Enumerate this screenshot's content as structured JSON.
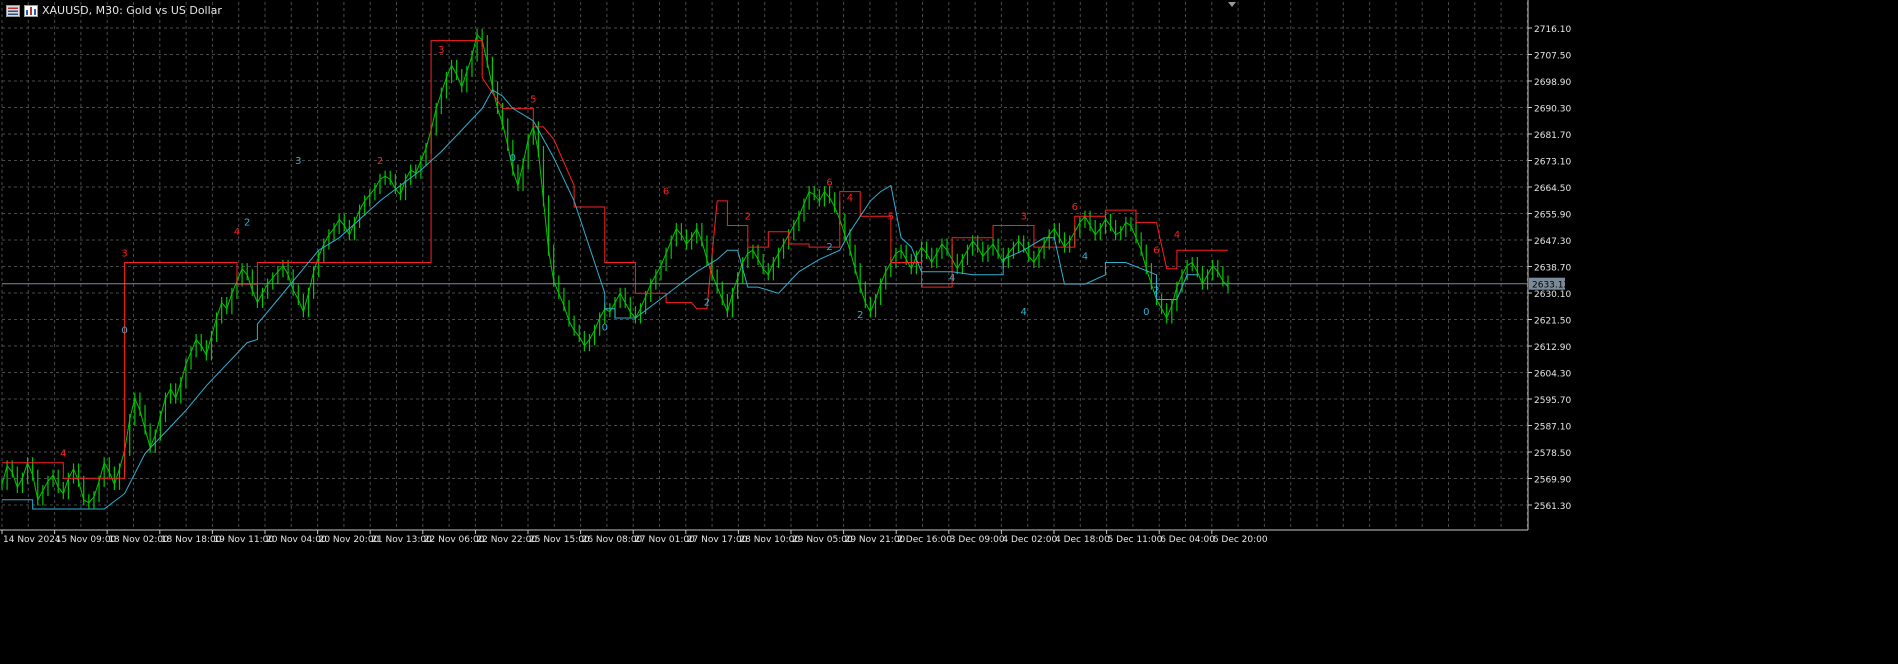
{
  "window": {
    "title": "XAUUSD, M30:  Gold vs US Dollar",
    "icons": [
      "chart-list-icon",
      "chart-bars-icon"
    ]
  },
  "colors": {
    "background": "#000000",
    "grid": "#4a4a4a",
    "axis": "#c8c8c8",
    "candles": "#00c800",
    "upper_stop": "#ff1e1e",
    "lower_stop": "#30b0d0",
    "current_price_line": "#7a8a99",
    "price_tag_bg": "#7a8a99",
    "text": "#e6e6e6"
  },
  "chart_data": {
    "type": "line",
    "symbol": "XAUUSD",
    "timeframe": "M30",
    "title": "XAUUSD, M30:  Gold vs US Dollar",
    "ylim": [
      2553.0,
      2722.0
    ],
    "y_ticks": [
      "2716.10",
      "2707.50",
      "2698.90",
      "2690.30",
      "2681.70",
      "2673.10",
      "2664.50",
      "2655.90",
      "2647.30",
      "2638.70",
      "2630.10",
      "2621.50",
      "2612.90",
      "2604.30",
      "2595.70",
      "2587.10",
      "2578.50",
      "2569.90",
      "2561.30"
    ],
    "x_ticks": [
      "14 Nov 2024",
      "15 Nov 09:00",
      "18 Nov 02:00",
      "18 Nov 18:00",
      "19 Nov 11:00",
      "20 Nov 04:00",
      "20 Nov 20:00",
      "21 Nov 13:00",
      "22 Nov 06:00",
      "22 Nov 22:00",
      "25 Nov 15:00",
      "26 Nov 08:00",
      "27 Nov 01:00",
      "27 Nov 17:00",
      "28 Nov 10:00",
      "29 Nov 05:00",
      "29 Nov 21:00",
      "2 Dec 16:00",
      "3 Dec 09:00",
      "4 Dec 02:00",
      "4 Dec 18:00",
      "5 Dec 11:00",
      "6 Dec 04:00",
      "6 Dec 20:00"
    ],
    "current_price": "2633.12",
    "series": [
      {
        "role": "price",
        "x": [
          0,
          1,
          2,
          3,
          4,
          5,
          6,
          7,
          8,
          9,
          10,
          11,
          12,
          13,
          14,
          15,
          16,
          17,
          18,
          19,
          20,
          21,
          22,
          23,
          24,
          25,
          26,
          27,
          28,
          29,
          30,
          31,
          32,
          33,
          34,
          35,
          36,
          37,
          38,
          39,
          40,
          41,
          42,
          43,
          44,
          45,
          46,
          47,
          48,
          49,
          50,
          51,
          52,
          53,
          54,
          55,
          56,
          57,
          58,
          59,
          60,
          61,
          62,
          63,
          64,
          65,
          66,
          67,
          68,
          69,
          70,
          71,
          72,
          73,
          74,
          75,
          76,
          77,
          78,
          79,
          80,
          81,
          82,
          83,
          84,
          85,
          86,
          87,
          88,
          89,
          90,
          91,
          92,
          93,
          94,
          95,
          96,
          97,
          98,
          99,
          100,
          101,
          102,
          103,
          104,
          105,
          106,
          107,
          108,
          109,
          110,
          111,
          112,
          113,
          114,
          115,
          116,
          117,
          118,
          119,
          120,
          121,
          122,
          123,
          124,
          125,
          126,
          127,
          128,
          129,
          130,
          131,
          132,
          133,
          134,
          135,
          136,
          137,
          138,
          139,
          140,
          141,
          142,
          143,
          144,
          145,
          146,
          147,
          148,
          149,
          150,
          151,
          152,
          153,
          154,
          155,
          156,
          157,
          158,
          159,
          160,
          161,
          162,
          163,
          164,
          165,
          166,
          167,
          168,
          169,
          170,
          171,
          172,
          173,
          174,
          175,
          176,
          177,
          178,
          179,
          180,
          181,
          182,
          183,
          184,
          185,
          186,
          187,
          188,
          189,
          190,
          191,
          192,
          193,
          194,
          195,
          196,
          197,
          198,
          199,
          200,
          201,
          202,
          203,
          204,
          205,
          206,
          207,
          208,
          209,
          210,
          211,
          212,
          213,
          214,
          215,
          216,
          217,
          218,
          219,
          220,
          221,
          222,
          223,
          224,
          225,
          226,
          227,
          228,
          229,
          230,
          231,
          232,
          233,
          234,
          235,
          236,
          237,
          238,
          239,
          240
        ],
        "y": [
          2568,
          2574,
          2572,
          2567,
          2570,
          2575,
          2571,
          2563,
          2566,
          2569,
          2571,
          2567,
          2565,
          2570,
          2573,
          2569,
          2563,
          2562,
          2564,
          2569,
          2575,
          2572,
          2568,
          2573,
          2579,
          2589,
          2596,
          2592,
          2586,
          2580,
          2584,
          2590,
          2596,
          2599,
          2596,
          2601,
          2607,
          2611,
          2615,
          2613,
          2610,
          2616,
          2622,
          2627,
          2625,
          2630,
          2634,
          2638,
          2636,
          2631,
          2627,
          2630,
          2633,
          2635,
          2637,
          2639,
          2636,
          2631,
          2628,
          2624,
          2630,
          2637,
          2642,
          2646,
          2649,
          2651,
          2654,
          2652,
          2649,
          2653,
          2657,
          2660,
          2662,
          2664,
          2667,
          2668,
          2667,
          2664,
          2662,
          2667,
          2670,
          2669,
          2673,
          2677,
          2683,
          2690,
          2695,
          2700,
          2704,
          2701,
          2697,
          2702,
          2707,
          2714,
          2712,
          2705,
          2697,
          2690,
          2685,
          2678,
          2670,
          2665,
          2672,
          2680,
          2684,
          2676,
          2660,
          2644,
          2634,
          2630,
          2626,
          2621,
          2618,
          2616,
          2613,
          2615,
          2618,
          2622,
          2625,
          2624,
          2627,
          2630,
          2627,
          2624,
          2622,
          2625,
          2629,
          2633,
          2636,
          2639,
          2643,
          2647,
          2651,
          2649,
          2646,
          2648,
          2651,
          2647,
          2641,
          2636,
          2632,
          2628,
          2624,
          2630,
          2635,
          2640,
          2643,
          2644,
          2641,
          2638,
          2636,
          2640,
          2643,
          2646,
          2649,
          2652,
          2655,
          2659,
          2663,
          2662,
          2660,
          2663,
          2661,
          2658,
          2654,
          2649,
          2644,
          2638,
          2632,
          2627,
          2624,
          2628,
          2633,
          2637,
          2640,
          2643,
          2644,
          2641,
          2638,
          2642,
          2645,
          2643,
          2640,
          2643,
          2646,
          2644,
          2641,
          2638,
          2641,
          2644,
          2647,
          2645,
          2642,
          2644,
          2646,
          2643,
          2640,
          2643,
          2645,
          2647,
          2645,
          2642,
          2640,
          2643,
          2646,
          2649,
          2651,
          2648,
          2645,
          2647,
          2650,
          2653,
          2655,
          2652,
          2649,
          2651,
          2654,
          2652,
          2649,
          2650,
          2653,
          2652,
          2648,
          2644,
          2638,
          2633,
          2628,
          2625,
          2622,
          2626,
          2632,
          2636,
          2639,
          2640,
          2637,
          2633,
          2636,
          2639,
          2637,
          2634,
          2632
        ]
      },
      {
        "role": "upper_stop",
        "x": [
          0,
          12,
          12,
          24,
          24,
          40,
          46,
          46,
          50,
          50,
          84,
          84,
          94,
          94,
          98,
          104,
          104,
          106,
          108,
          112,
          112,
          118,
          118,
          124,
          124,
          130,
          130,
          135,
          136,
          138,
          140,
          142,
          142,
          146,
          146,
          150,
          150,
          154,
          154,
          158,
          158,
          164,
          164,
          168,
          168,
          174,
          174,
          180,
          180,
          186,
          186,
          194,
          194,
          202,
          202,
          210,
          210,
          216,
          216,
          222,
          222,
          226,
          228,
          230,
          230,
          240
        ],
        "y": [
          2575,
          2575,
          2570,
          2570,
          2640,
          2640,
          2640,
          2633,
          2633,
          2640,
          2640,
          2712,
          2712,
          2700,
          2690,
          2690,
          2684,
          2684,
          2680,
          2665,
          2658,
          2658,
          2640,
          2640,
          2630,
          2630,
          2627,
          2627,
          2625,
          2625,
          2660,
          2660,
          2652,
          2652,
          2645,
          2645,
          2650,
          2650,
          2646,
          2646,
          2645,
          2645,
          2663,
          2663,
          2655,
          2655,
          2640,
          2640,
          2632,
          2632,
          2648,
          2648,
          2652,
          2652,
          2645,
          2645,
          2655,
          2655,
          2657,
          2657,
          2653,
          2653,
          2638,
          2638,
          2644,
          2644
        ]
      },
      {
        "role": "lower_stop",
        "x": [
          0,
          6,
          6,
          20,
          24,
          28,
          32,
          36,
          40,
          44,
          48,
          50,
          50,
          54,
          58,
          62,
          66,
          70,
          74,
          78,
          82,
          86,
          90,
          94,
          96,
          98,
          100,
          104,
          108,
          112,
          116,
          118,
          118,
          120,
          120,
          124,
          128,
          132,
          136,
          140,
          142,
          144,
          146,
          148,
          152,
          156,
          160,
          164,
          166,
          168,
          170,
          172,
          174,
          176,
          178,
          180,
          186,
          190,
          194,
          196,
          196,
          200,
          204,
          206,
          208,
          212,
          216,
          216,
          220,
          226,
          226,
          230,
          232,
          234
        ],
        "y": [
          2563,
          2563,
          2560,
          2560,
          2565,
          2578,
          2585,
          2592,
          2600,
          2607,
          2614,
          2615,
          2620,
          2628,
          2636,
          2644,
          2648,
          2654,
          2660,
          2665,
          2670,
          2676,
          2683,
          2690,
          2696,
          2694,
          2690,
          2686,
          2674,
          2660,
          2640,
          2630,
          2625,
          2625,
          2622,
          2622,
          2627,
          2632,
          2637,
          2641,
          2644,
          2644,
          2632,
          2632,
          2630,
          2637,
          2641,
          2644,
          2650,
          2655,
          2660,
          2663,
          2665,
          2648,
          2645,
          2637,
          2637,
          2636,
          2636,
          2636,
          2641,
          2644,
          2648,
          2648,
          2633,
          2633,
          2636,
          2640,
          2640,
          2636,
          2628,
          2628,
          2636,
          2636
        ]
      }
    ],
    "counter_labels": [
      {
        "text": "4",
        "role": "upper",
        "x": 12,
        "y": 2577
      },
      {
        "text": "3",
        "role": "upper",
        "x": 24,
        "y": 2642
      },
      {
        "text": "0",
        "role": "lower",
        "x": 24,
        "y": 2617
      },
      {
        "text": "4",
        "role": "upper",
        "x": 46,
        "y": 2649
      },
      {
        "text": "2",
        "role": "lower",
        "x": 48,
        "y": 2652
      },
      {
        "text": "3",
        "role": "lower",
        "x": 58,
        "y": 2672
      },
      {
        "text": "2",
        "role": "upper",
        "x": 74,
        "y": 2672
      },
      {
        "text": "3",
        "role": "upper",
        "x": 86,
        "y": 2708
      },
      {
        "text": "0",
        "role": "lower",
        "x": 100,
        "y": 2673
      },
      {
        "text": "5",
        "role": "upper",
        "x": 104,
        "y": 2692
      },
      {
        "text": "0",
        "role": "lower",
        "x": 118,
        "y": 2618
      },
      {
        "text": "6",
        "role": "upper",
        "x": 130,
        "y": 2662
      },
      {
        "text": "2",
        "role": "lower",
        "x": 138,
        "y": 2626
      },
      {
        "text": "2",
        "role": "upper",
        "x": 146,
        "y": 2654
      },
      {
        "text": "6",
        "role": "upper",
        "x": 162,
        "y": 2665
      },
      {
        "text": "4",
        "role": "upper",
        "x": 166,
        "y": 2660
      },
      {
        "text": "2",
        "role": "lower",
        "x": 162,
        "y": 2644
      },
      {
        "text": "2",
        "role": "lower",
        "x": 168,
        "y": 2622
      },
      {
        "text": "5",
        "role": "upper",
        "x": 174,
        "y": 2654
      },
      {
        "text": "4",
        "role": "lower",
        "x": 186,
        "y": 2634
      },
      {
        "text": "3",
        "role": "upper",
        "x": 200,
        "y": 2654
      },
      {
        "text": "4",
        "role": "lower",
        "x": 200,
        "y": 2623
      },
      {
        "text": "6",
        "role": "upper",
        "x": 210,
        "y": 2657
      },
      {
        "text": "4",
        "role": "lower",
        "x": 212,
        "y": 2641
      },
      {
        "text": "0",
        "role": "lower",
        "x": 224,
        "y": 2623
      },
      {
        "text": "6",
        "role": "upper",
        "x": 226,
        "y": 2643
      },
      {
        "text": "4",
        "role": "upper",
        "x": 230,
        "y": 2648
      },
      {
        "text": "2",
        "role": "lower",
        "x": 226,
        "y": 2630
      }
    ]
  }
}
